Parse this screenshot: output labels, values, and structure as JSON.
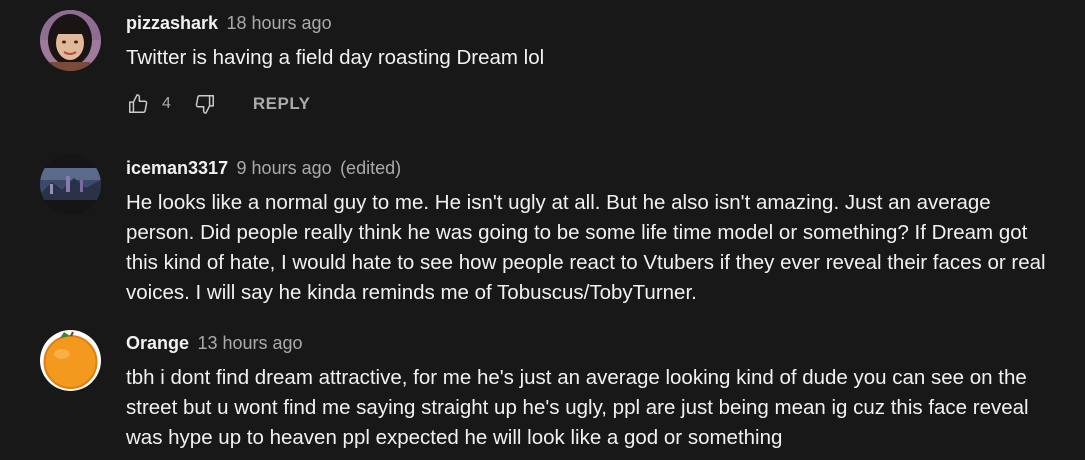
{
  "comments": [
    {
      "author": "pizzashark",
      "time": "18 hours ago",
      "edited": "",
      "text": "Twitter is having a field day roasting Dream lol",
      "like_count": "4",
      "reply_label": "REPLY",
      "avatar_icon": "person-avatar"
    },
    {
      "author": "iceman3317",
      "time": "9 hours ago",
      "edited": "(edited)",
      "text": "He looks like a normal guy to me. He isn't ugly at all. But he also isn't amazing. Just an average person. Did people really think he was going to be some life time model or something? If Dream got this kind of hate, I would hate to see how people react to Vtubers if they ever reveal their faces or real voices. I will say he kinda reminds me of Tobuscus/TobyTurner.",
      "avatar_icon": "landscape-avatar"
    },
    {
      "author": "Orange",
      "time": "13 hours ago",
      "edited": "",
      "text": "tbh i dont find dream attractive, for me he's just an average looking kind of dude you can see on the street but u wont find me saying straight up he's ugly, ppl are just being mean ig cuz this face reveal was hype up to heaven ppl expected he will look like a god or something",
      "avatar_icon": "orange-fruit-avatar"
    }
  ],
  "colors": {
    "background": "#181818",
    "primary_text": "#f1f1f1",
    "secondary_text": "#aaaaaa"
  }
}
